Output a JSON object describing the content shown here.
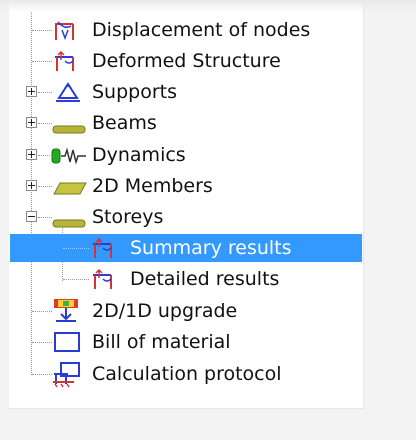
{
  "colors": {
    "selection": "#3399ff",
    "beam_icon": "#9b9b2a",
    "dynamics_icon": "#22aa22",
    "node_icon_red": "#d33333",
    "node_icon_blue": "#2b3bd8"
  },
  "tree": {
    "items": [
      {
        "label": "Displacement of nodes",
        "icon": "displacement-nodes-icon",
        "expander": "none"
      },
      {
        "label": "Deformed Structure",
        "icon": "deformed-structure-icon",
        "expander": "none"
      },
      {
        "label": "Supports",
        "icon": "supports-icon",
        "expander": "collapsed"
      },
      {
        "label": "Beams",
        "icon": "beams-icon",
        "expander": "collapsed"
      },
      {
        "label": "Dynamics",
        "icon": "dynamics-icon",
        "expander": "collapsed"
      },
      {
        "label": "2D Members",
        "icon": "2d-members-icon",
        "expander": "collapsed"
      },
      {
        "label": "Storeys",
        "icon": "storeys-icon",
        "expander": "expanded",
        "children": [
          {
            "label": "Summary results",
            "icon": "summary-results-icon",
            "selected": true
          },
          {
            "label": "Detailed results",
            "icon": "detailed-results-icon",
            "selected": false
          }
        ]
      },
      {
        "label": "2D/1D upgrade",
        "icon": "upgrade-2d1d-icon",
        "expander": "none"
      },
      {
        "label": "Bill of material",
        "icon": "bill-of-material-icon",
        "expander": "none"
      },
      {
        "label": "Calculation protocol",
        "icon": "calculation-protocol-icon",
        "expander": "none"
      }
    ]
  }
}
